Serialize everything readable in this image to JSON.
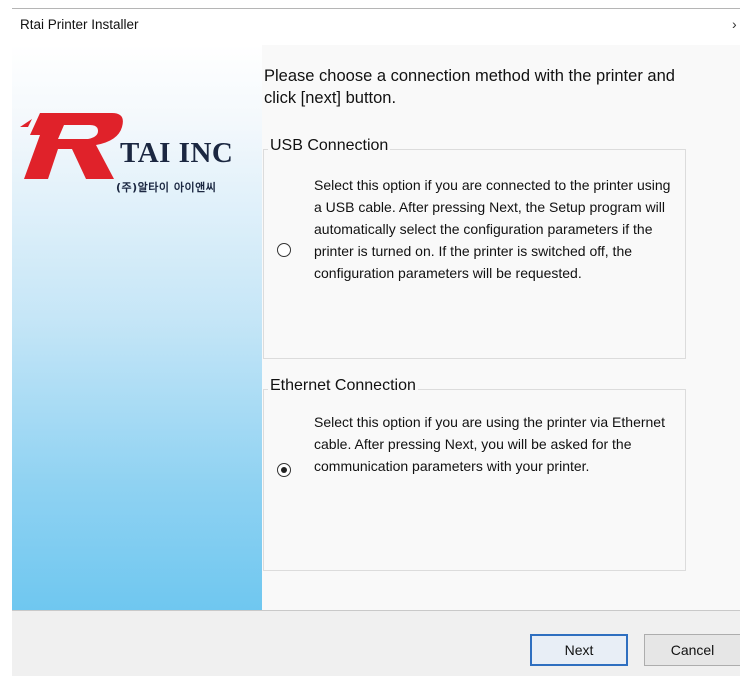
{
  "window": {
    "title": "Rtai Printer Installer",
    "close_glyph": "›"
  },
  "logo": {
    "name": "TAI INC",
    "subtitle": "(주)알타이 아이앤씨",
    "brand_color": "#e0222a"
  },
  "instruction": "Please choose a connection method with the printer and click [next] button.",
  "options": {
    "usb": {
      "label": "USB Connection",
      "description": "Select this option if you are connected to the printer using a USB cable. After pressing Next, the Setup program will automatically select the configuration parameters if the printer is turned on. If the printer is switched off, the configuration parameters will be requested.",
      "selected": false
    },
    "ethernet": {
      "label": "Ethernet Connection",
      "description": "Select this option if you are using the printer via Ethernet cable. After pressing Next, you will be asked for the communication parameters with your printer.",
      "selected": true
    }
  },
  "buttons": {
    "next": "Next",
    "cancel": "Cancel"
  }
}
